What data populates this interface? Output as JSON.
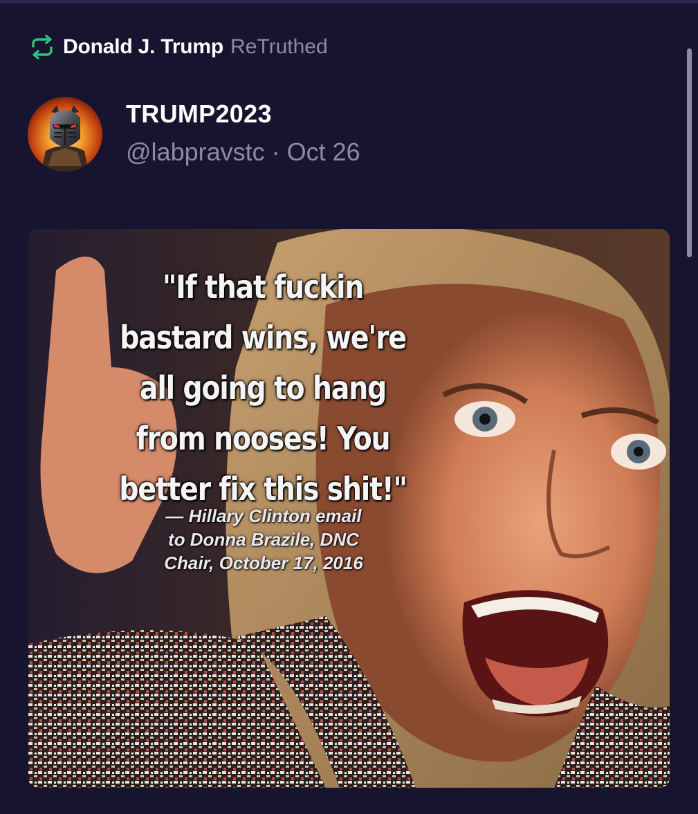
{
  "retruth": {
    "icon": "retruth-icon",
    "author": "Donald J. Trump",
    "label": "ReTruthed",
    "accent_color": "#2ec27e"
  },
  "post": {
    "display_name": "TRUMP2023",
    "handle": "@labpravstc",
    "separator": "·",
    "date": "Oct 26",
    "avatar": "knight-helmet-avatar",
    "media": {
      "quote_lines": [
        "\"If that fuckin",
        "bastard wins, we're",
        "all going to hang",
        "from nooses! You",
        "better fix this shit!\""
      ],
      "attribution_lines": [
        "— Hillary Clinton email",
        "to Donna Brazile, DNC",
        "Chair, October 17, 2016"
      ]
    }
  },
  "theme": {
    "background": "#17142f",
    "muted_text": "#8d8aa5",
    "primary_text": "#ffffff"
  }
}
